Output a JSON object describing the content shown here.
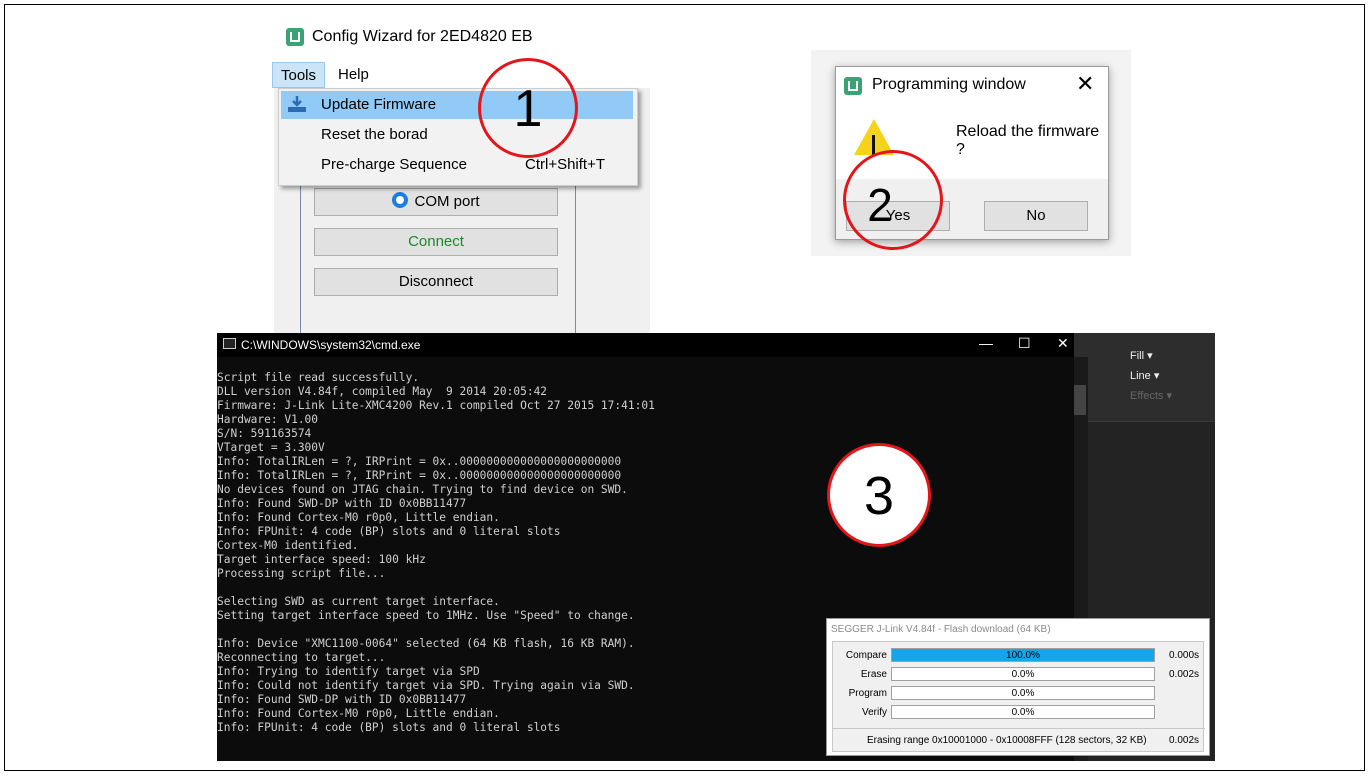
{
  "wizard": {
    "title": "Config Wizard for 2ED4820 EB",
    "menu": {
      "tools": "Tools",
      "help": "Help"
    },
    "dropdown": [
      {
        "label": "Update Firmware",
        "shortcut": "",
        "highlighted": true
      },
      {
        "label": "Reset the borad",
        "shortcut": ""
      },
      {
        "label": "Pre-charge Sequence",
        "shortcut": "Ctrl+Shift+T"
      }
    ],
    "buttons": {
      "com_port": "COM port",
      "connect": "Connect",
      "disconnect": "Disconnect"
    },
    "colors": {
      "connect_text": "#1a8a2a",
      "menu_highlight": "#91c9f7"
    }
  },
  "dialog": {
    "title": "Programming window",
    "close": "✕",
    "message": "Reload the firmware ?",
    "yes": "Yes",
    "no": "No"
  },
  "cmd": {
    "title": "C:\\WINDOWS\\system32\\cmd.exe",
    "controls": {
      "minimize": "—",
      "maximize": "☐",
      "close": "✕"
    },
    "lines": [
      "Script file read successfully.",
      "DLL version V4.84f, compiled May  9 2014 20:05:42",
      "Firmware: J-Link Lite-XMC4200 Rev.1 compiled Oct 27 2015 17:41:01",
      "Hardware: V1.00",
      "S/N: 591163574",
      "VTarget = 3.300V",
      "Info: TotalIRLen = ?, IRPrint = 0x..000000000000000000000000",
      "Info: TotalIRLen = ?, IRPrint = 0x..000000000000000000000000",
      "No devices found on JTAG chain. Trying to find device on SWD.",
      "Info: Found SWD-DP with ID 0x0BB11477",
      "Info: Found Cortex-M0 r0p0, Little endian.",
      "Info: FPUnit: 4 code (BP) slots and 0 literal slots",
      "Cortex-M0 identified.",
      "Target interface speed: 100 kHz",
      "Processing script file...",
      "",
      "Selecting SWD as current target interface.",
      "Setting target interface speed to 1MHz. Use \"Speed\" to change.",
      "",
      "Info: Device \"XMC1100-0064\" selected (64 KB flash, 16 KB RAM).",
      "Reconnecting to target...",
      "Info: Trying to identify target via SPD",
      "Info: Could not identify target via SPD. Trying again via SWD.",
      "Info: Found SWD-DP with ID 0x0BB11477",
      "Info: Found Cortex-M0 r0p0, Little endian.",
      "Info: FPUnit: 4 code (BP) slots and 0 literal slots"
    ]
  },
  "side_app": {
    "fill": "Fill ▾",
    "line": "Line ▾",
    "effects": "Effects ▾"
  },
  "jlink": {
    "title": "SEGGER J-Link V4.84f - Flash download (64 KB)",
    "rows": [
      {
        "label": "Compare",
        "percent": "100.0%",
        "progress": 1.0,
        "time": "0.000s"
      },
      {
        "label": "Erase",
        "percent": "0.0%",
        "progress": 0.0,
        "time": "0.002s"
      },
      {
        "label": "Program",
        "percent": "0.0%",
        "progress": 0.0,
        "time": ""
      },
      {
        "label": "Verify",
        "percent": "0.0%",
        "progress": 0.0,
        "time": ""
      }
    ],
    "status": "Erasing range 0x10001000 - 0x10008FFF (128 sectors, 32 KB)",
    "status_time": "0.002s",
    "bar_color": "#11a7e8"
  },
  "annotations": {
    "step1": "1",
    "step2": "2",
    "step3": "3"
  }
}
